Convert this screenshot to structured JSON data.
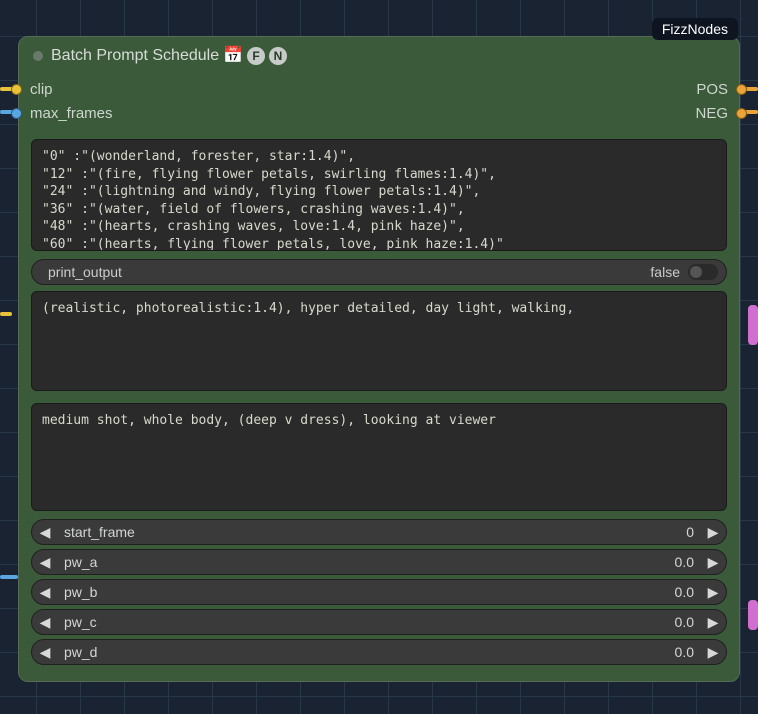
{
  "tag": "FizzNodes",
  "node": {
    "title": "Batch Prompt Schedule",
    "badges": {
      "calendar": "📅",
      "f": "F",
      "n": "N"
    }
  },
  "ports": {
    "in": [
      {
        "name": "clip",
        "color": "yellow"
      },
      {
        "name": "max_frames",
        "color": "blue"
      }
    ],
    "out": [
      {
        "name": "POS",
        "color": "orange"
      },
      {
        "name": "NEG",
        "color": "orange"
      }
    ]
  },
  "textareas": {
    "schedule": "\"0\" :\"(wonderland, forester, star:1.4)\",\n\"12\" :\"(fire, flying flower petals, swirling flames:1.4)\",\n\"24\" :\"(lightning and windy, flying flower petals:1.4)\",\n\"36\" :\"(water, field of flowers, crashing waves:1.4)\",\n\"48\" :\"(hearts, crashing waves, love:1.4, pink haze)\",\n\"60\" :\"(hearts, flying flower petals, love, pink haze:1.4)\"",
    "positive": "(realistic, photorealistic:1.4), hyper detailed, day light, walking,",
    "negative": "medium shot, whole body, (deep v dress), looking at viewer"
  },
  "print_output": {
    "label": "print_output",
    "value": "false"
  },
  "numbers": [
    {
      "label": "start_frame",
      "value": "0"
    },
    {
      "label": "pw_a",
      "value": "0.0"
    },
    {
      "label": "pw_b",
      "value": "0.0"
    },
    {
      "label": "pw_c",
      "value": "0.0"
    },
    {
      "label": "pw_d",
      "value": "0.0"
    }
  ]
}
